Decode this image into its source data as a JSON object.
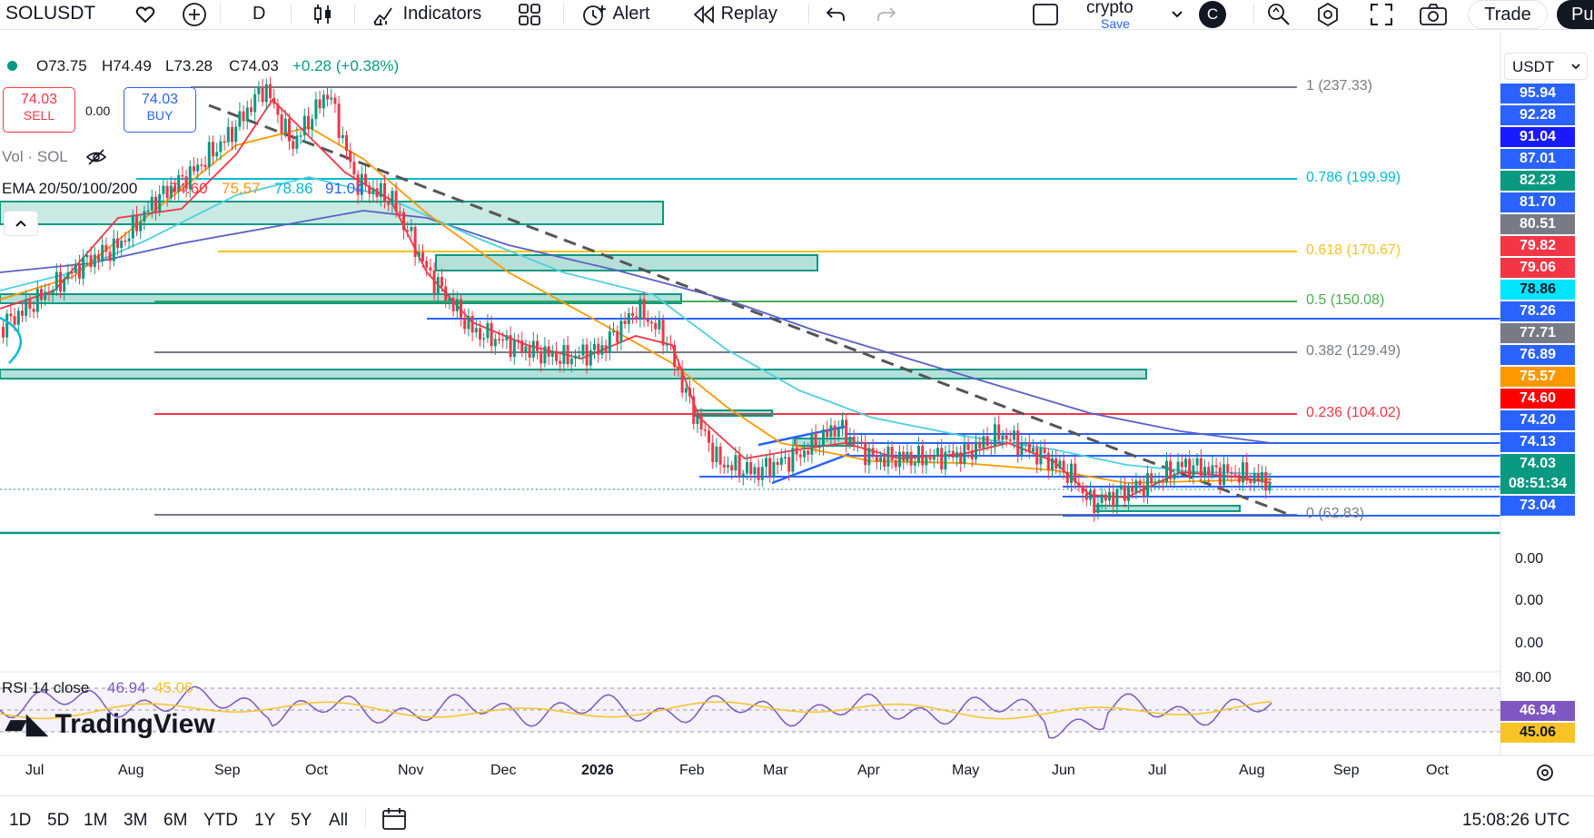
{
  "toolbar": {
    "symbol": "SOLUSDT",
    "interval": "D",
    "indicators_label": "Indicators",
    "alert_label": "Alert",
    "replay_label": "Replay",
    "layout_name": "crypto",
    "layout_save": "Save",
    "avatar_letter": "C",
    "trade_label": "Trade",
    "publish_label": "Pu"
  },
  "legend": {
    "open": "O73.75",
    "high": "H74.49",
    "low": "L73.28",
    "close": "C74.03",
    "change": "+0.28 (+0.38%)",
    "sell_price": "74.03",
    "sell_label": "SELL",
    "spread": "0.00",
    "buy_price": "74.03",
    "buy_label": "BUY",
    "vol_label": "Vol · SOL",
    "ema_label": "EMA 20/50/100/200",
    "ema20": "74.60",
    "ema50": "75.57",
    "ema100": "78.86",
    "ema200": "91.04",
    "rsi_label": "RSI 14 close",
    "rsi_value": "46.94",
    "rsi_ma": "45.06"
  },
  "currency": "USDT",
  "fib_levels": [
    {
      "label": "1 (237.33)",
      "color": "#787b86"
    },
    {
      "label": "0.786 (199.99)",
      "color": "#00bcd4"
    },
    {
      "label": "0.618 (170.67)",
      "color": "#f7c325"
    },
    {
      "label": "0.5 (150.08)",
      "color": "#4caf50"
    },
    {
      "label": "0.382 (129.49)",
      "color": "#787b86"
    },
    {
      "label": "0.236 (104.02)",
      "color": "#f23645"
    },
    {
      "label": "0 (62.83)",
      "color": "#787b86"
    }
  ],
  "price_axis": [
    {
      "v": "95.94",
      "bg": "#2962ff"
    },
    {
      "v": "92.28",
      "bg": "#2962ff"
    },
    {
      "v": "91.04",
      "bg": "#1a1aff"
    },
    {
      "v": "87.01",
      "bg": "#2962ff"
    },
    {
      "v": "82.23",
      "bg": "#089981"
    },
    {
      "v": "81.70",
      "bg": "#2962ff"
    },
    {
      "v": "80.51",
      "bg": "#787b86"
    },
    {
      "v": "79.82",
      "bg": "#f23645"
    },
    {
      "v": "79.06",
      "bg": "#f23645"
    },
    {
      "v": "78.86",
      "bg": "#00e5ff"
    },
    {
      "v": "78.26",
      "bg": "#2962ff"
    },
    {
      "v": "77.71",
      "bg": "#787b86"
    },
    {
      "v": "76.89",
      "bg": "#2962ff"
    },
    {
      "v": "75.57",
      "bg": "#ff9800"
    },
    {
      "v": "74.60",
      "bg": "#ff0000"
    },
    {
      "v": "74.20",
      "bg": "#2962ff"
    },
    {
      "v": "74.13",
      "bg": "#2962ff"
    },
    {
      "v": "74.03",
      "bg": "#089981"
    },
    {
      "v": "08:51:34",
      "bg": "#089981"
    },
    {
      "v": "73.04",
      "bg": "#2962ff"
    }
  ],
  "volume_axis": [
    "0.00",
    "0.00",
    "0.00"
  ],
  "rsi_axis": {
    "top": "80.00",
    "value": "46.94",
    "ma": "45.06"
  },
  "time_axis": [
    "Jul",
    "Aug",
    "Sep",
    "Oct",
    "Nov",
    "Dec",
    "2026",
    "Feb",
    "Mar",
    "Apr",
    "May",
    "Jun",
    "Jul",
    "Aug",
    "Sep",
    "Oct"
  ],
  "ranges": [
    "1D",
    "5D",
    "1M",
    "3M",
    "6M",
    "YTD",
    "1Y",
    "5Y",
    "All"
  ],
  "clock": "15:08:26 UTC",
  "watermark": "TradingView",
  "colors": {
    "up": "#089981",
    "down": "#f23645",
    "ema20": "#f23645",
    "ema50": "#ff9800",
    "ema100": "#00e5ff",
    "ema200": "#5b5fc7",
    "trend": "#131722",
    "rsi": "#7e57c2",
    "rsi_ma": "#f7c325"
  }
}
